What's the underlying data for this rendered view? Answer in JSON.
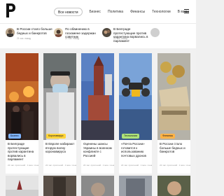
{
  "header": {
    "logo_letter": "P",
    "nav": [
      "Все новости",
      "Бизнес",
      "Политика",
      "Финансы",
      "Технологии",
      "В мире"
    ]
  },
  "top_news": [
    {
      "title": "В России стало больше бедных и банкротов",
      "meta": "21 час. назад"
    },
    {
      "title": "По обвинению в госизмене задержан советник",
      "meta": "21 час. назад"
    },
    {
      "title": "В Белграде протестующие против карантина ворвались в парламент",
      "meta": "21 час. назад"
    },
    {
      "title": "",
      "meta": ""
    }
  ],
  "cards": [
    {
      "badge": "Бизнес",
      "badge_color": "#7fb4ff",
      "title": "В Белграде протестующие против карантина ворвались в парламент",
      "meta": "22 час. прочтений · 1 мин. чтения"
    },
    {
      "badge": "Коронавирус",
      "badge_color": "#ffd43b",
      "title": "В Европе набирают вторую волну коронавируса",
      "meta": "22 час. прочтений · 1 мин. чтения"
    },
    {
      "badge": "",
      "badge_color": "",
      "title": "Оценены шансы Украины в военном конфликте с Россией",
      "meta": "22 час. прочтений · 1 мин. чтения"
    },
    {
      "badge": "Технологии",
      "badge_color": "#aee37a",
      "title": "«Почта России» готовится к использованию почтовых дронов",
      "meta": "22 час. прочтений · 1 мин. чтения"
    },
    {
      "badge": "Финансы",
      "badge_color": "#ffb347",
      "title": "В России стало больше бедных и банкротов",
      "meta": "22 час. прочтений · 1 мин. чтения"
    }
  ]
}
